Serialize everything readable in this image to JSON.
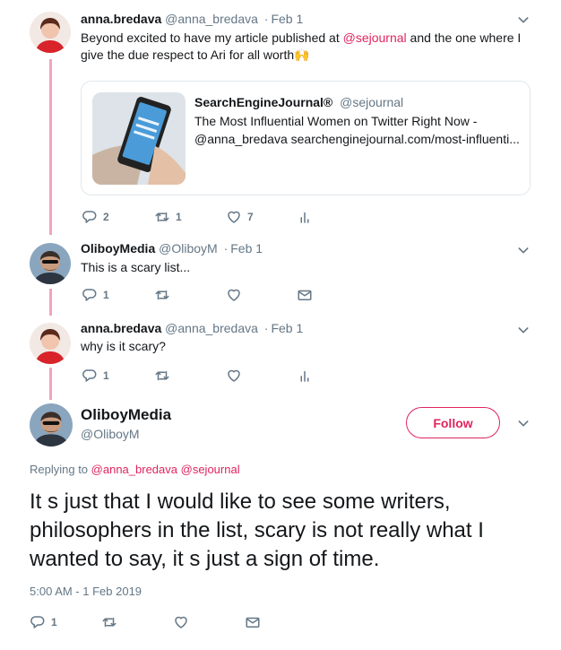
{
  "tweet1": {
    "name": "anna.bredava",
    "handle": "@anna_bredava",
    "date": "Feb 1",
    "text_before": "Beyond excited to have my article published at ",
    "mention": "@sejournal",
    "text_after": " and the one where I give the due respect to Ari for all worth",
    "emoji": "🙌",
    "card": {
      "site_name": "SearchEngineJournal®",
      "site_handle": "@sejournal",
      "title": "The Most Influential Women on Twitter Right Now -",
      "description": "@anna_bredava searchenginejournal.com/most-influenti..."
    },
    "actions": {
      "replies": "2",
      "retweets": "1",
      "likes": "7"
    }
  },
  "tweet2": {
    "name": "OliboyMedia",
    "handle": "@OliboyM",
    "date": "Feb 1",
    "text": "This is a scary list...",
    "actions": {
      "replies": "1"
    }
  },
  "tweet3": {
    "name": "anna.bredava",
    "handle": "@anna_bredava",
    "date": "Feb 1",
    "text": "why is it scary?",
    "actions": {
      "replies": "1"
    }
  },
  "main": {
    "name": "OliboyMedia",
    "handle": "@OliboyM",
    "follow_label": "Follow",
    "replying_to_label": "Replying to",
    "replying_to_1": "@anna_bredava",
    "replying_to_2": "@sejournal",
    "text": "It s just that I would like to see some writers, philosophers in the list, scary is not really what I wanted to say, it s just a sign of time.",
    "timestamp": "5:00 AM - 1 Feb 2019",
    "actions": {
      "replies": "1"
    }
  },
  "icons": {
    "reply": "reply-icon",
    "retweet": "retweet-icon",
    "like": "heart-icon",
    "analytics": "analytics-icon",
    "dm": "envelope-icon",
    "caret": "chevron-down-icon"
  },
  "colors": {
    "accent": "#e0245e",
    "thread_line": "#f2a3c0",
    "muted": "#657786",
    "text": "#14171a"
  }
}
